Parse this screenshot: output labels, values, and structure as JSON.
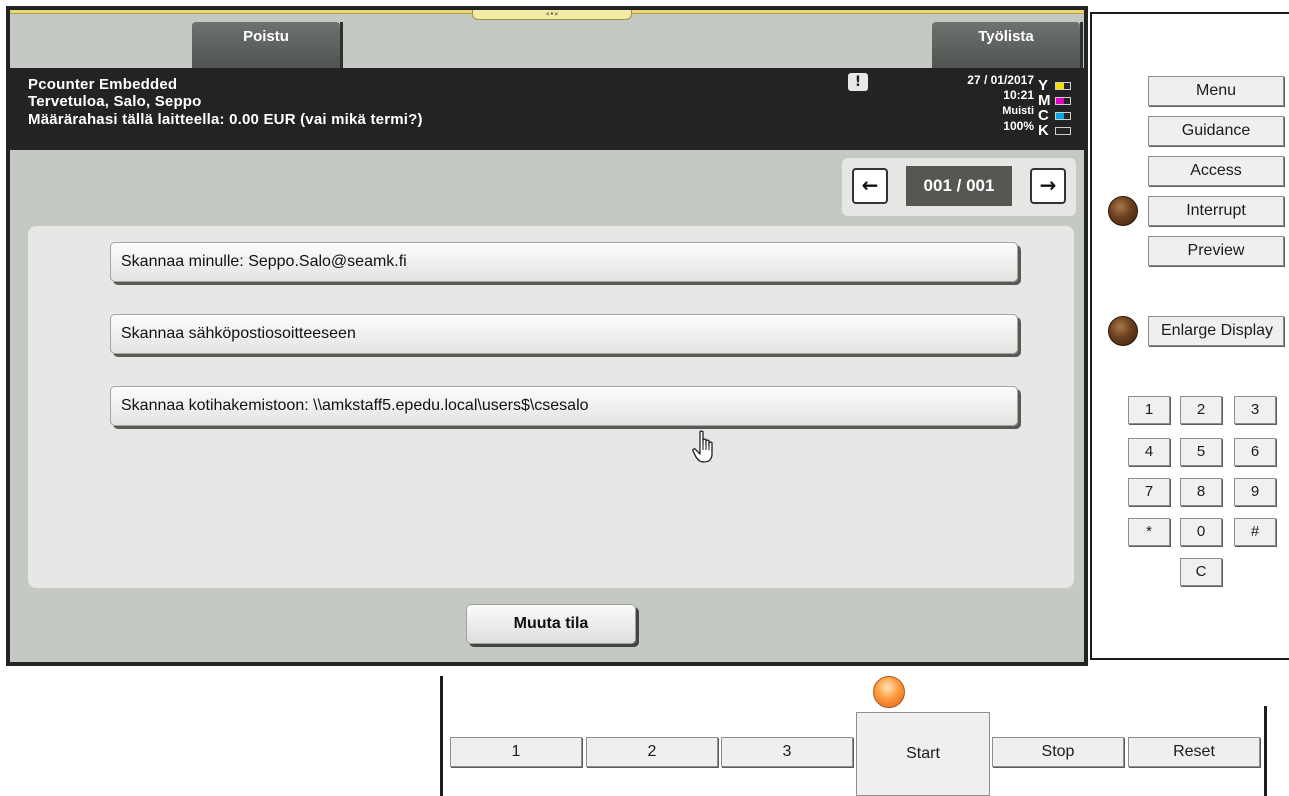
{
  "screen": {
    "drag_handle_label": "«•»",
    "tabs": {
      "poistu": "Poistu",
      "tyolista": "Työlista"
    },
    "info": {
      "line1": "Pcounter Embedded",
      "line2": "Tervetuloa, Salo, Seppo",
      "line3": "Määrärahasi tällä laitteella: 0.00 EUR (vai mikä termi?)"
    },
    "alert_icon": "!",
    "status": {
      "date": "27 / 01/2017",
      "time": "10:21",
      "memory": "Muisti",
      "percent": "100%"
    },
    "toner": [
      {
        "letter": "Y",
        "color": "#f2e000",
        "level": 0.6
      },
      {
        "letter": "M",
        "color": "#e000c8",
        "level": 0.6
      },
      {
        "letter": "C",
        "color": "#00a6e6",
        "level": 0.6
      },
      {
        "letter": "K",
        "color": "#262626",
        "level": 0.0
      }
    ],
    "pager": {
      "prev": "←",
      "count": "001 / 001",
      "next": "→"
    },
    "list": [
      "Skannaa minulle: Seppo.Salo@seamk.fi",
      "Skannaa sähköpostiosoitteeseen",
      "Skannaa kotihakemistoon: \\\\amkstaff5.epedu.local\\users$\\csesalo"
    ],
    "mode_button": "Muuta tila"
  },
  "side_panel": {
    "buttons": [
      "Menu",
      "Guidance",
      "Access",
      "Interrupt",
      "Preview",
      "Enlarge Display"
    ],
    "keypad": [
      "1",
      "2",
      "3",
      "4",
      "5",
      "6",
      "7",
      "8",
      "9",
      "*",
      "0",
      "#"
    ],
    "clear": "C"
  },
  "bottom_bar": {
    "buttons": [
      "1",
      "2",
      "3"
    ],
    "start": "Start",
    "stop": "Stop",
    "reset": "Reset"
  }
}
